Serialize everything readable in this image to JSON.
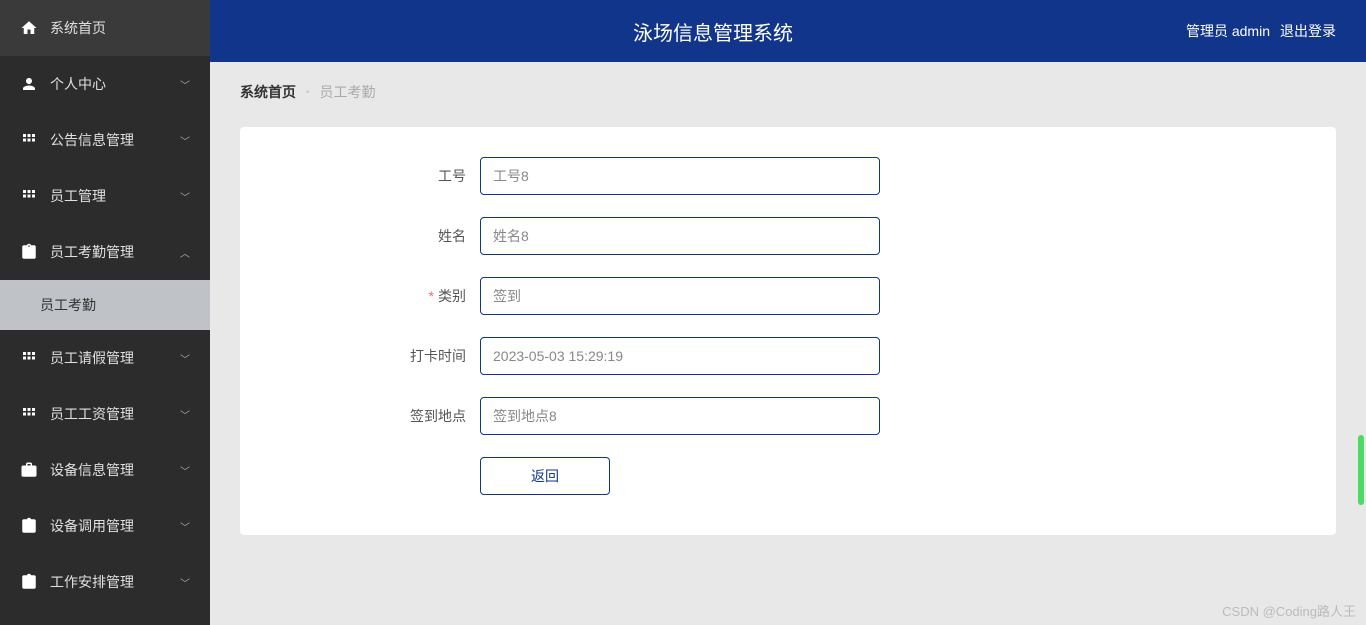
{
  "header": {
    "title": "泳场信息管理系统",
    "user_prefix": "管理员",
    "user_name": "admin",
    "logout": "退出登录"
  },
  "sidebar": {
    "items": [
      {
        "label": "系统首页",
        "icon": "home",
        "expandable": false
      },
      {
        "label": "个人中心",
        "icon": "user",
        "expandable": true,
        "expanded": false
      },
      {
        "label": "公告信息管理",
        "icon": "grid",
        "expandable": true,
        "expanded": false
      },
      {
        "label": "员工管理",
        "icon": "grid",
        "expandable": true,
        "expanded": false
      },
      {
        "label": "员工考勤管理",
        "icon": "clipboard",
        "expandable": true,
        "expanded": true,
        "children": [
          {
            "label": "员工考勤",
            "active": true
          }
        ]
      },
      {
        "label": "员工请假管理",
        "icon": "grid",
        "expandable": true,
        "expanded": false
      },
      {
        "label": "员工工资管理",
        "icon": "grid",
        "expandable": true,
        "expanded": false
      },
      {
        "label": "设备信息管理",
        "icon": "briefcase",
        "expandable": true,
        "expanded": false
      },
      {
        "label": "设备调用管理",
        "icon": "clipboard",
        "expandable": true,
        "expanded": false
      },
      {
        "label": "工作安排管理",
        "icon": "clipboard",
        "expandable": true,
        "expanded": false
      }
    ]
  },
  "breadcrumb": {
    "home": "系统首页",
    "current": "员工考勤"
  },
  "form": {
    "fields": [
      {
        "label": "工号",
        "value": "工号8",
        "required": false
      },
      {
        "label": "姓名",
        "value": "姓名8",
        "required": false
      },
      {
        "label": "类别",
        "value": "签到",
        "required": true
      },
      {
        "label": "打卡时间",
        "value": "2023-05-03 15:29:19",
        "required": false
      },
      {
        "label": "签到地点",
        "value": "签到地点8",
        "required": false
      }
    ],
    "back_button": "返回"
  },
  "watermark": "CSDN @Coding路人王"
}
